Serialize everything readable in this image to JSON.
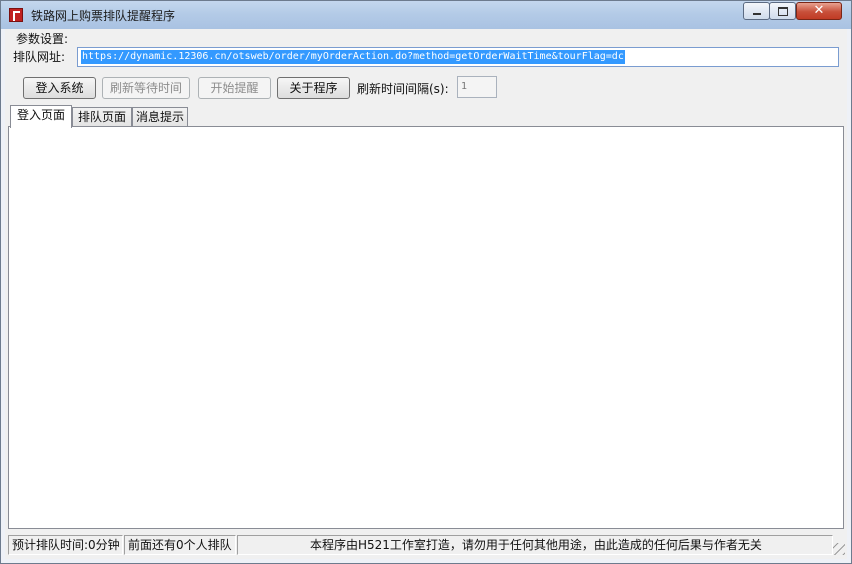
{
  "window": {
    "title": "铁路网上购票排队提醒程序",
    "controls": {
      "minimize": "minimize",
      "maximize": "maximize",
      "close": "✕"
    }
  },
  "params": {
    "section_label": "参数设置:",
    "url_label": "排队网址:",
    "url_value": "https://dynamic.12306.cn/otsweb/order/myOrderAction.do?method=getOrderWaitTime&tourFlag=dc"
  },
  "toolbar": {
    "login_label": "登入系统",
    "refresh_wait_label": "刷新等待时间",
    "start_remind_label": "开始提醒",
    "about_label": "关于程序",
    "interval_label": "刷新时间间隔(s):",
    "interval_value": "1"
  },
  "tabs": [
    {
      "label": "登入页面",
      "active": true
    },
    {
      "label": "排队页面",
      "active": false
    },
    {
      "label": "消息提示",
      "active": false
    }
  ],
  "status": {
    "estimate": "预计排队时间:0分钟",
    "queue_ahead": "前面还有0个人排队",
    "disclaimer": "本程序由H521工作室打造，请勿用于任何其他用途，由此造成的任何后果与作者无关"
  }
}
